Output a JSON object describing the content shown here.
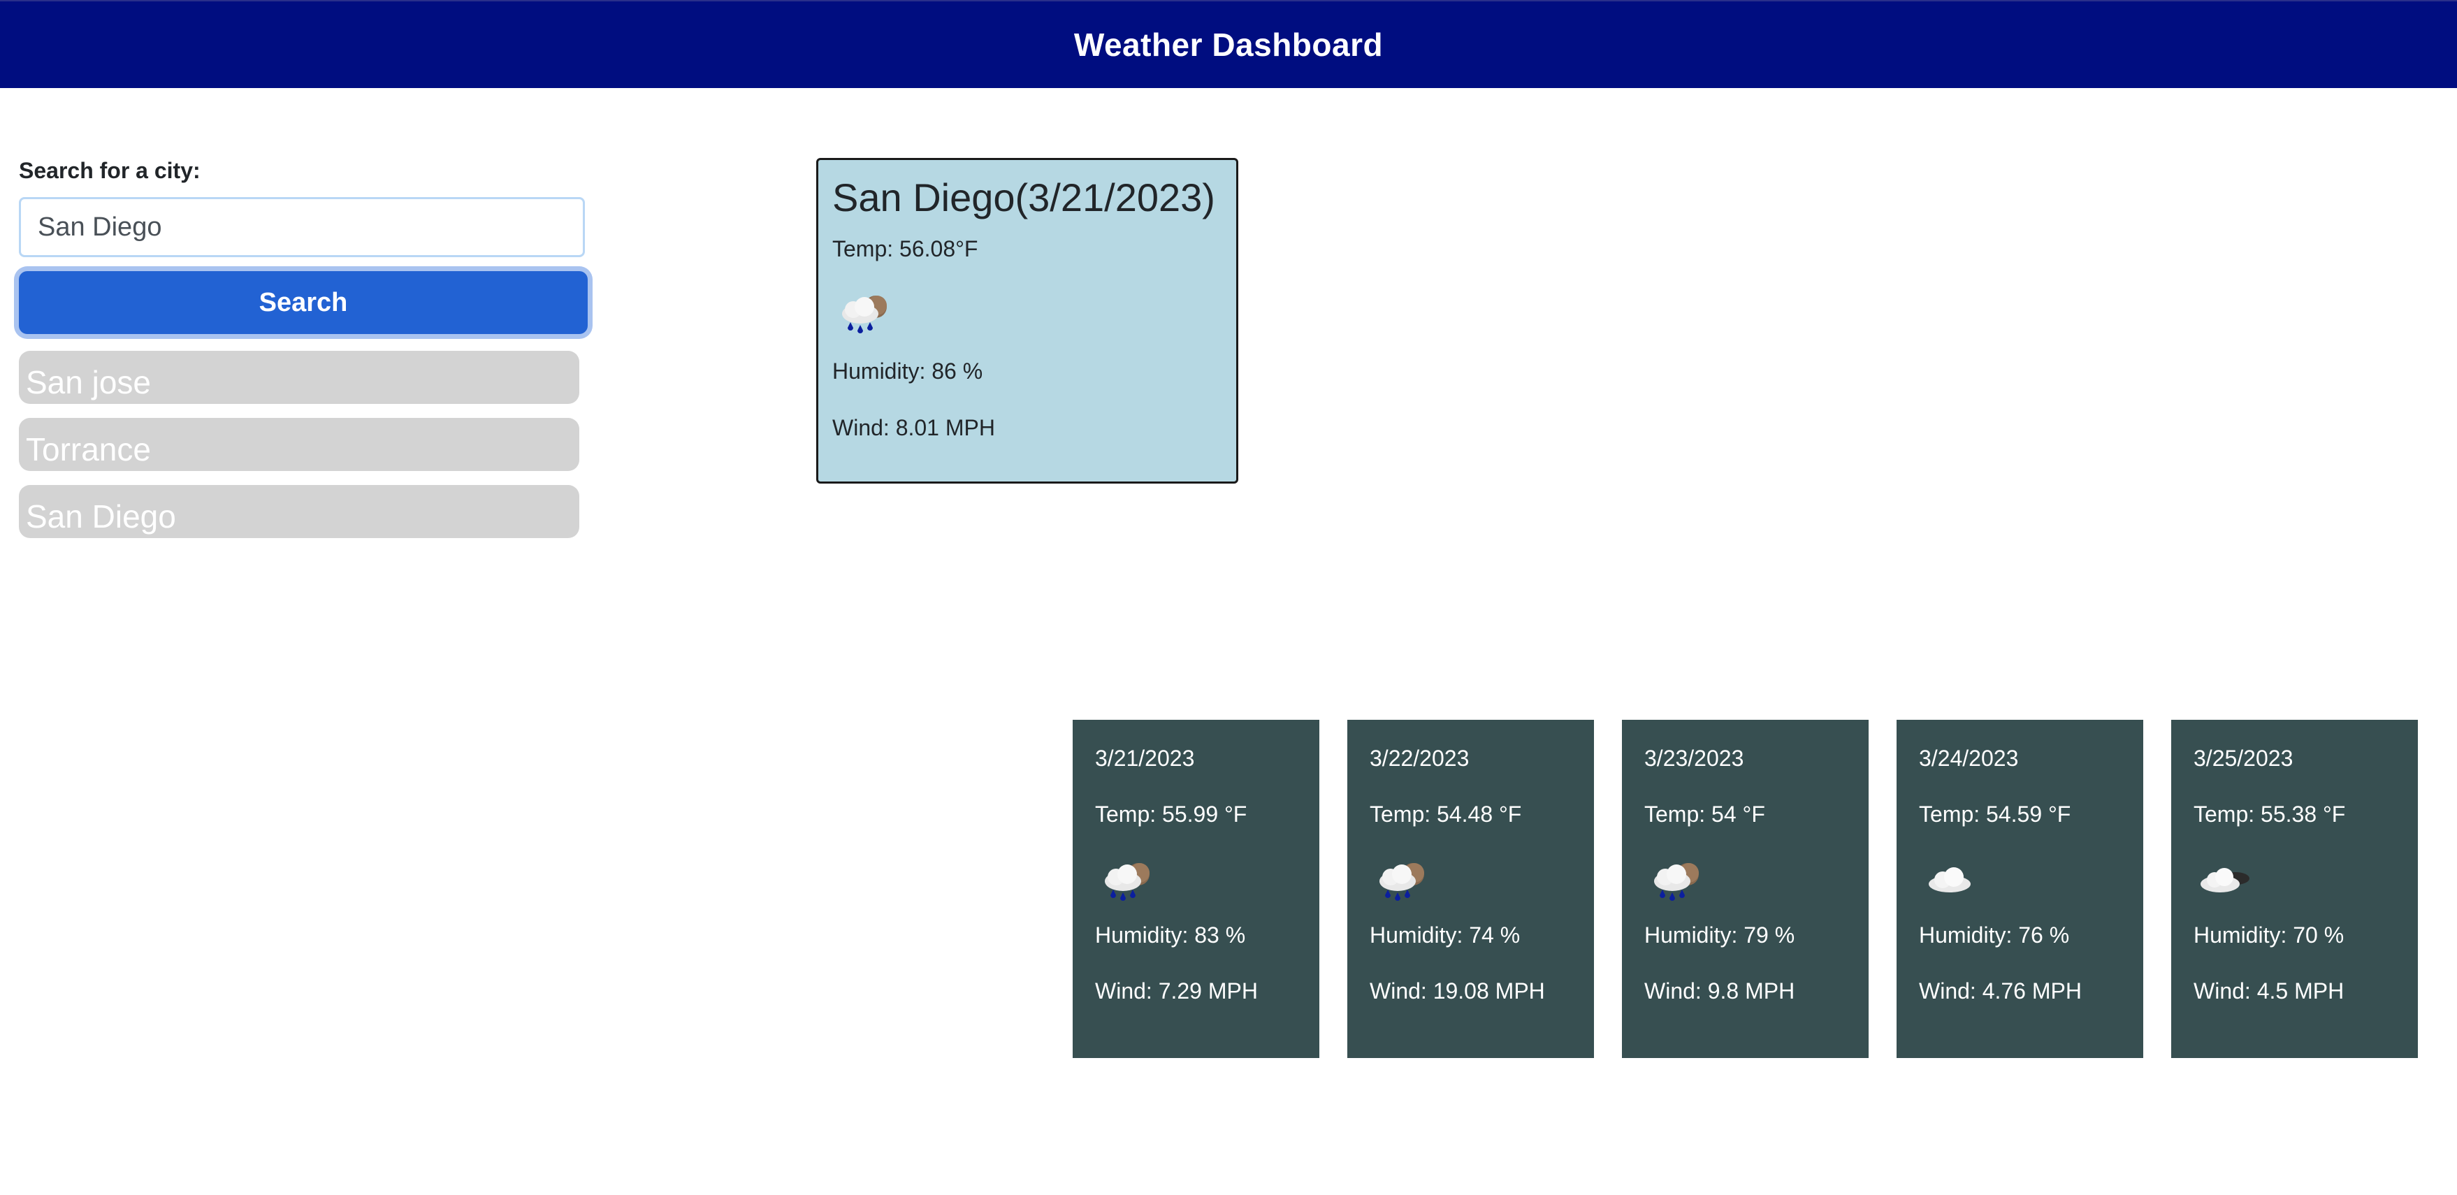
{
  "header": {
    "title": "Weather Dashboard"
  },
  "search": {
    "label": "Search for a city:",
    "input_value": "San Diego",
    "button_label": "Search"
  },
  "history": [
    {
      "label": "San jose"
    },
    {
      "label": "Torrance"
    },
    {
      "label": "San Diego"
    }
  ],
  "current": {
    "title": "San Diego(3/21/2023)",
    "temp": "Temp: 56.08°F",
    "icon": "rain-cloud-icon",
    "humidity": "Humidity: 86 %",
    "wind": "Wind: 8.01 MPH"
  },
  "forecast": [
    {
      "date": "3/21/2023",
      "temp": "Temp: 55.99 °F",
      "icon": "rain-cloud-icon",
      "humidity": "Humidity: 83 %",
      "wind": "Wind: 7.29 MPH"
    },
    {
      "date": "3/22/2023",
      "temp": "Temp: 54.48 °F",
      "icon": "rain-cloud-icon",
      "humidity": "Humidity: 74 %",
      "wind": "Wind: 19.08 MPH"
    },
    {
      "date": "3/23/2023",
      "temp": "Temp: 54 °F",
      "icon": "rain-cloud-icon",
      "humidity": "Humidity: 79 %",
      "wind": "Wind: 9.8 MPH"
    },
    {
      "date": "3/24/2023",
      "temp": "Temp: 54.59 °F",
      "icon": "cloud-icon",
      "humidity": "Humidity: 76 %",
      "wind": "Wind: 4.76 MPH"
    },
    {
      "date": "3/25/2023",
      "temp": "Temp: 55.38 °F",
      "icon": "partly-cloudy-night-icon",
      "humidity": "Humidity: 70 %",
      "wind": "Wind: 4.5 MPH"
    }
  ],
  "colors": {
    "header_bg": "#000d80",
    "search_button": "#2262d3",
    "current_card_bg": "#b6d8e3",
    "forecast_card_bg": "#374f51",
    "history_item_bg": "#d3d3d3"
  }
}
